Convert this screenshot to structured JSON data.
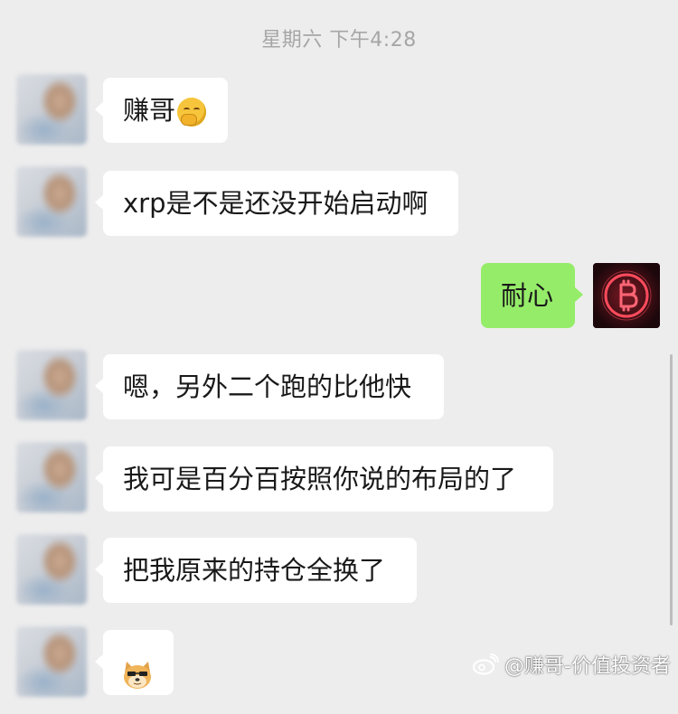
{
  "timestamp": "星期六 下午4:28",
  "messages": [
    {
      "side": "left",
      "text": "赚哥",
      "emoji": "shushing-face-icon"
    },
    {
      "side": "left",
      "text": "xrp是不是还没开始启动啊"
    },
    {
      "side": "right",
      "text": "耐心",
      "avatar": "bitcoin-icon"
    },
    {
      "side": "left",
      "text": "嗯，另外二个跑的比他快"
    },
    {
      "side": "left",
      "text": "我可是百分百按照你说的布局的了"
    },
    {
      "side": "left",
      "text": "把我原来的持仓全换了"
    },
    {
      "side": "left",
      "text": "",
      "emoji": "doge-icon"
    }
  ],
  "watermark": "@赚哥-价值投资者",
  "colors": {
    "background": "#ededed",
    "incoming_bubble": "#ffffff",
    "outgoing_bubble": "#95ec69",
    "timestamp_text": "#a6a6a6"
  }
}
